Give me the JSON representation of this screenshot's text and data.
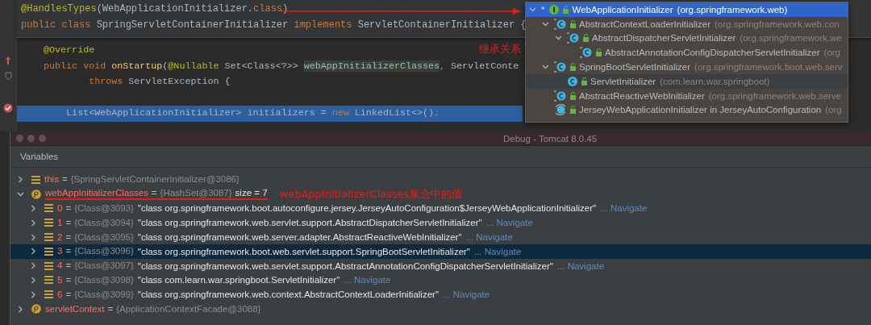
{
  "editor": {
    "sticky_lines": [
      [
        {
          "kind": "annotation",
          "text": "@HandlesTypes"
        },
        {
          "kind": "plain",
          "text": "(WebApplicationInitializer."
        },
        {
          "kind": "keyword",
          "text": "class"
        },
        {
          "kind": "plain",
          "text": ")"
        }
      ],
      [
        {
          "kind": "keyword",
          "text": "public class "
        },
        {
          "kind": "plain",
          "text": "SpringServletContainerInitializer "
        },
        {
          "kind": "keyword",
          "text": "implements "
        },
        {
          "kind": "plain",
          "text": "ServletContainerInitializer {"
        }
      ]
    ],
    "lines": [
      {
        "kind": "plain",
        "selected": false,
        "segments": [
          {
            "kind": "annotation",
            "text": "    @Override"
          }
        ]
      },
      {
        "kind": "override",
        "selected": false,
        "segments": [
          {
            "kind": "keyword",
            "text": "    public void "
          },
          {
            "kind": "method",
            "text": "onStartup"
          },
          {
            "kind": "plain",
            "text": "("
          },
          {
            "kind": "annotation",
            "text": "@Nullable "
          },
          {
            "kind": "plain",
            "text": "Set<Class<?>> "
          },
          {
            "kind": "param",
            "text": "webAppInitializerClasses"
          },
          {
            "kind": "keyword",
            "text": ", "
          },
          {
            "kind": "plain",
            "text": "ServletConte"
          }
        ]
      },
      {
        "kind": "fold",
        "selected": false,
        "segments": [
          {
            "kind": "keyword",
            "text": "            throws "
          },
          {
            "kind": "plain",
            "text": "ServletException {"
          }
        ]
      },
      {
        "kind": "blank"
      },
      {
        "kind": "breakpoint",
        "selected": true,
        "segments": [
          {
            "kind": "plain",
            "text": "        List<WebApplicationInitializer> initializers = "
          },
          {
            "kind": "keyword",
            "text": "new "
          },
          {
            "kind": "plain",
            "text": "LinkedList<>()"
          },
          {
            "kind": "keyword",
            "text": ";"
          }
        ]
      }
    ],
    "note": "继承关系"
  },
  "hierarchy": {
    "items": [
      {
        "marker": "*",
        "kind": "interface",
        "name": "WebApplicationInitializer",
        "package": "(org.springframework.web)",
        "selected": true,
        "library": true,
        "children": [
          {
            "kind": "abstract",
            "name": "AbstractContextLoaderInitializer",
            "package": "(org.springframework.web.con",
            "selected": false,
            "library": true,
            "children": [
              {
                "kind": "abstract",
                "name": "AbstractDispatcherServletInitializer",
                "package": "(org.springframework.we",
                "selected": false,
                "library": true,
                "children": [
                  {
                    "kind": "abstract",
                    "name": "AbstractAnnotationConfigDispatcherServletInitializer",
                    "package": "(org",
                    "selected": false,
                    "library": true
                  }
                ]
              }
            ]
          },
          {
            "kind": "abstract",
            "name": "SpringBootServletInitializer",
            "package": "(org.springframework.boot.web.serv",
            "selected": false,
            "library": true,
            "children": [
              {
                "kind": "class",
                "name": "ServletInitializer",
                "package": "(com.learn.war.springboot)",
                "selected": false,
                "library": false
              }
            ]
          },
          {
            "kind": "abstract",
            "name": "AbstractReactiveWebInitializer",
            "package": "(org.springframework.web.serve",
            "selected": false,
            "library": true
          },
          {
            "kind": "nested",
            "name": "JerseyWebApplicationInitializer in JerseyAutoConfiguration",
            "package": "(org",
            "selected": false,
            "library": true
          }
        ]
      }
    ]
  },
  "debug": {
    "title": "Debug - Tomcat 8.0.45",
    "panel": "Variables",
    "variables": [
      {
        "kind": "field",
        "name": "this",
        "operator": "=",
        "ref": "{SpringServletContainerInitializer@3086}",
        "expanded": false,
        "selected": false,
        "underlined": false
      },
      {
        "kind": "param",
        "name": "webAppInitializerClasses",
        "operator": "=",
        "ref": "{HashSet@3087}",
        "extra": "size = 7",
        "note": "webAppInitializerClasses集合中的值",
        "expanded": true,
        "selected": false,
        "underlined": true,
        "children": [
          {
            "kind": "field",
            "name": "0",
            "operator": "=",
            "ref": "{Class@3093}",
            "value": "\"class org.springframework.boot.autoconfigure.jersey.JerseyAutoConfiguration$JerseyWebApplicationInitializer\"",
            "navigate": "... Navigate",
            "expanded": false,
            "selected": false
          },
          {
            "kind": "field",
            "name": "1",
            "operator": "=",
            "ref": "{Class@3094}",
            "value": "\"class org.springframework.web.servlet.support.AbstractDispatcherServletInitializer\"",
            "navigate": "... Navigate",
            "expanded": false,
            "selected": false
          },
          {
            "kind": "field",
            "name": "2",
            "operator": "=",
            "ref": "{Class@3095}",
            "value": "\"class org.springframework.web.server.adapter.AbstractReactiveWebInitializer\"",
            "navigate": "... Navigate",
            "expanded": false,
            "selected": false
          },
          {
            "kind": "field",
            "name": "3",
            "operator": "=",
            "ref": "{Class@3096}",
            "value": "\"class org.springframework.boot.web.servlet.support.SpringBootServletInitializer\"",
            "navigate": "... Navigate",
            "expanded": false,
            "selected": true
          },
          {
            "kind": "field",
            "name": "4",
            "operator": "=",
            "ref": "{Class@3097}",
            "value": "\"class org.springframework.web.servlet.support.AbstractAnnotationConfigDispatcherServletInitializer\"",
            "navigate": "... Navigate",
            "expanded": false,
            "selected": false
          },
          {
            "kind": "field",
            "name": "5",
            "operator": "=",
            "ref": "{Class@3098}",
            "value": "\"class com.learn.war.springboot.ServletInitializer\"",
            "navigate": "... Navigate",
            "expanded": false,
            "selected": false
          },
          {
            "kind": "field",
            "name": "6",
            "operator": "=",
            "ref": "{Class@3099}",
            "value": "\"class org.springframework.web.context.AbstractContextLoaderInitializer\"",
            "navigate": "... Navigate",
            "expanded": false,
            "selected": false
          }
        ]
      },
      {
        "kind": "param",
        "name": "servletContext",
        "operator": "=",
        "ref": "{ApplicationContextFacade@3088}",
        "expanded": false,
        "selected": false,
        "underlined": false
      }
    ]
  }
}
